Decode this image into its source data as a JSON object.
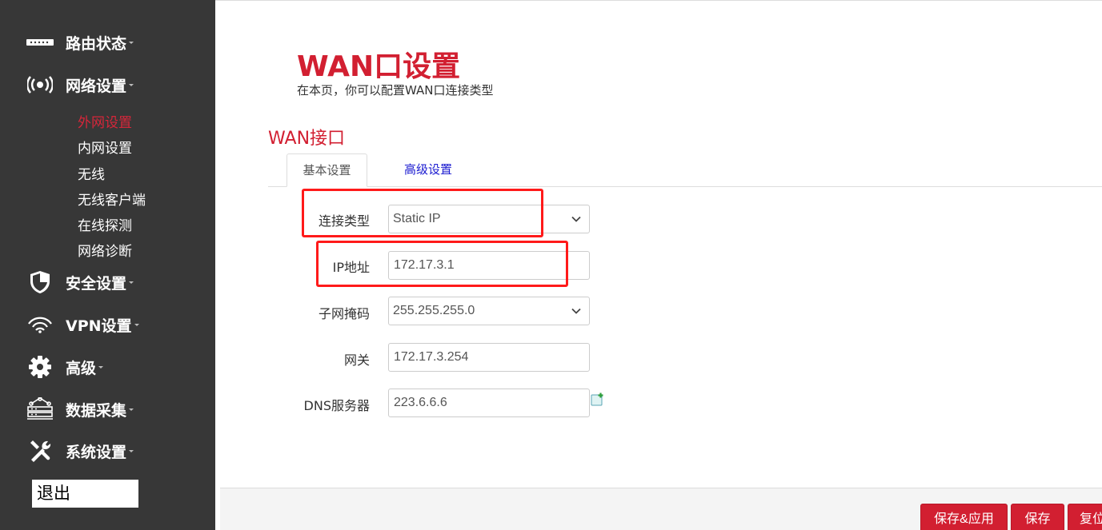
{
  "sidebar": {
    "menu": [
      {
        "label": "路由状态",
        "icon": "router-icon"
      },
      {
        "label": "网络设置",
        "icon": "wireless-signal-icon"
      },
      {
        "label": "安全设置",
        "icon": "shield-icon"
      },
      {
        "label": "VPN设置",
        "icon": "vpn-signal-icon"
      },
      {
        "label": "高级",
        "icon": "gear-icon"
      },
      {
        "label": "数据采集",
        "icon": "data-collection-icon"
      },
      {
        "label": "系统设置",
        "icon": "tools-icon"
      }
    ],
    "network_submenu": [
      "外网设置",
      "内网设置",
      "无线",
      "无线客户端",
      "在线探测",
      "网络诊断"
    ],
    "active_submenu": "外网设置",
    "logout_label": "退出"
  },
  "page": {
    "title": "WAN口设置",
    "description": "在本页，你可以配置WAN口连接类型"
  },
  "section": {
    "title": "WAN接口",
    "tabs": [
      {
        "label": "基本设置",
        "active": true
      },
      {
        "label": "高级设置",
        "active": false
      }
    ]
  },
  "form": {
    "connection_type": {
      "label": "连接类型",
      "value": "Static IP"
    },
    "ip_address": {
      "label": "IP地址",
      "value": "172.17.3.1"
    },
    "subnet_mask": {
      "label": "子网掩码",
      "value": "255.255.255.0"
    },
    "gateway": {
      "label": "网关",
      "value": "172.17.3.254"
    },
    "dns": {
      "label": "DNS服务器",
      "value": "223.6.6.6"
    }
  },
  "footer": {
    "save_apply_label": "保存&应用",
    "save_label": "保存",
    "reset_label": "复位"
  },
  "colors": {
    "accent": "#d21f31",
    "sidebar_bg": "#373737",
    "highlight_box": "#ff1a1a",
    "tab_link": "#1a1ad0"
  }
}
